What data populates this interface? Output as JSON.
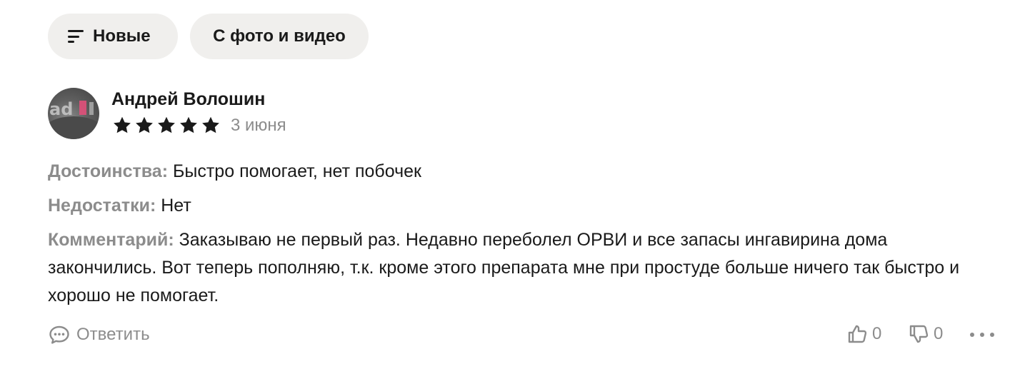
{
  "filters": {
    "sort_label": "Новые",
    "media_label": "С фото и видео"
  },
  "review": {
    "author": "Андрей Волошин",
    "rating": 5,
    "rating_max": 5,
    "date": "3 июня",
    "pros_label": "Достоинства:",
    "pros_text": "Быстро помогает, нет побочек",
    "cons_label": "Недостатки:",
    "cons_text": "Нет",
    "comment_label": "Комментарий:",
    "comment_text": "Заказываю не первый раз. Недавно переболел ОРВИ и все запасы ингавирина дома закончились. Вот теперь пополняю, т.к. кроме этого препарата мне при простуде больше ничего так быстро и хорошо не помогает."
  },
  "actions": {
    "reply_label": "Ответить",
    "likes": "0",
    "dislikes": "0"
  },
  "icons": {
    "sort": "sort-lines-icon",
    "reply": "comment-bubble-icon",
    "like": "thumbs-up-icon",
    "dislike": "thumbs-down-icon",
    "more": "more-dots-icon",
    "star": "star-icon"
  },
  "colors": {
    "chip_bg": "#f0efed",
    "text": "#1a1a1a",
    "muted": "#8c8c8c",
    "star": "#1a1a1a"
  }
}
